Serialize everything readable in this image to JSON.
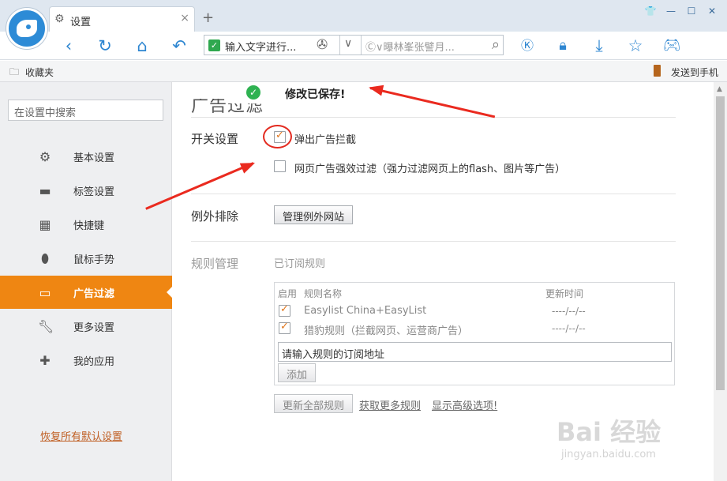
{
  "browser": {
    "tab_title": "设置",
    "tab_close": "×",
    "new_tab": "+",
    "address_text": "输入文字进行...",
    "search_placeholder": "Ⓒ∨曝林峯张譬月...",
    "window_buttons": [
      "👕",
      "—",
      "☐",
      "✕"
    ],
    "favorites_label": "收藏夹",
    "send_to_phone": "发送到手机",
    "nav_icons": [
      "back-icon",
      "refresh-icon",
      "home-icon",
      "undo-icon",
      "shield-k-icon",
      "lock-icon",
      "download-icon",
      "star-icon",
      "gamepad-icon"
    ]
  },
  "sidebar": {
    "search_placeholder": "在设置中搜索",
    "items": [
      {
        "label": "基本设置",
        "icon": "gear-icon",
        "active": false
      },
      {
        "label": "标签设置",
        "icon": "tab-icon",
        "active": false
      },
      {
        "label": "快捷键",
        "icon": "shortcut-icon",
        "active": false
      },
      {
        "label": "鼠标手势",
        "icon": "mouse-icon",
        "active": false
      },
      {
        "label": "广告过滤",
        "icon": "ad-filter-icon",
        "active": true
      },
      {
        "label": "更多设置",
        "icon": "wrench-icon",
        "active": false
      },
      {
        "label": "我的应用",
        "icon": "puzzle-icon",
        "active": false
      }
    ],
    "restore_defaults": "恢复所有默认设置"
  },
  "main": {
    "heading": "广告过滤",
    "toast": "修改已保存!",
    "switch_section": {
      "title": "开关设置",
      "popup_block": {
        "label": "弹出广告拦截",
        "checked": true
      },
      "strong_filter": {
        "label": "网页广告强效过滤（强力过滤网页上的flash、图片等广告）",
        "checked": false
      }
    },
    "exception_section": {
      "title": "例外排除",
      "button": "管理例外网站"
    },
    "rules_section": {
      "title": "规则管理",
      "subtitle": "已订阅规则",
      "headers": [
        "启用",
        "规则名称",
        "更新时间"
      ],
      "rules": [
        {
          "name": "Easylist China+EasyList",
          "time": "----/--/--",
          "enabled": true
        },
        {
          "name": "猎豹规则（拦截网页、运营商广告）",
          "time": "----/--/--",
          "enabled": true
        }
      ],
      "input_placeholder": "请输入规则的订阅地址",
      "add_button": "添加",
      "update_all_button": "更新全部规则",
      "more_rules_link": "获取更多规则",
      "advanced_link": "显示高级选项!"
    }
  },
  "watermark": {
    "big": "Bai 经验",
    "small": "jingyan.baidu.com"
  },
  "colors": {
    "accent": "#ef8612",
    "link_blue": "#2d86d1",
    "success": "#2eb251",
    "annotation_red": "#ea2a1f"
  }
}
